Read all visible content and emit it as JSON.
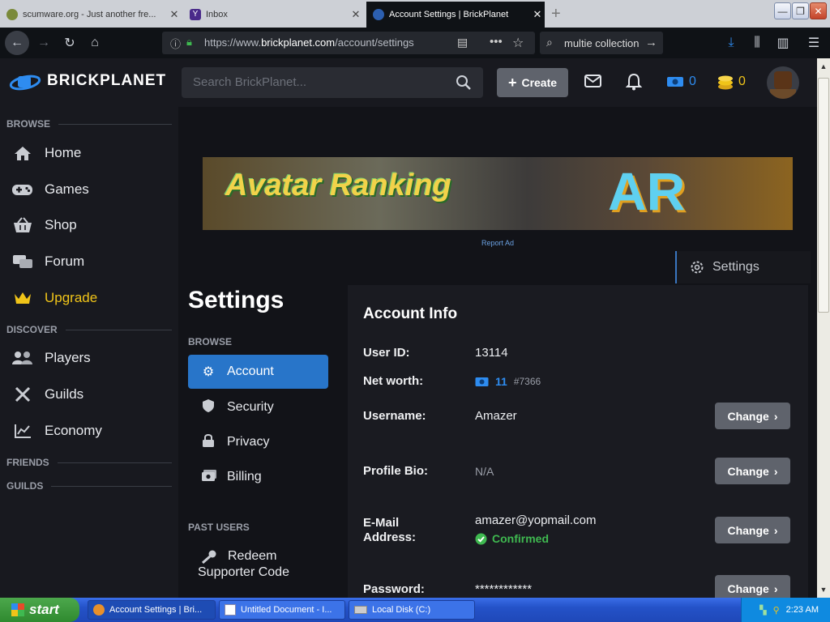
{
  "browser": {
    "tabs": [
      {
        "title": "scumware.org - Just another fre...",
        "active": false
      },
      {
        "title": "Inbox",
        "active": false
      },
      {
        "title": "Account Settings | BrickPlanet",
        "active": true
      }
    ],
    "url_prefix": "https://www.",
    "url_domain": "brickplanet.com",
    "url_path": "/account/settings",
    "search_value": "multie collection"
  },
  "header": {
    "logo": "BRICKPLANET",
    "search_placeholder": "Search BrickPlanet...",
    "create_label": "Create",
    "credits": "0",
    "bits": "0"
  },
  "sidebar": {
    "browse_label": "BROWSE",
    "browse_items": [
      {
        "label": "Home",
        "icon": "home-icon"
      },
      {
        "label": "Games",
        "icon": "gamepad-icon"
      },
      {
        "label": "Shop",
        "icon": "basket-icon"
      },
      {
        "label": "Forum",
        "icon": "comments-icon"
      },
      {
        "label": "Upgrade",
        "icon": "crown-icon"
      }
    ],
    "discover_label": "DISCOVER",
    "discover_items": [
      {
        "label": "Players",
        "icon": "users-icon"
      },
      {
        "label": "Guilds",
        "icon": "swords-icon"
      },
      {
        "label": "Economy",
        "icon": "chart-icon"
      }
    ],
    "friends_label": "FRIENDS",
    "guilds_label": "GUILDS"
  },
  "ad": {
    "banner_title": "Avatar Ranking",
    "banner_mark": "AR",
    "report_label": "Report Ad"
  },
  "settings_tab": "Settings",
  "settings": {
    "title": "Settings",
    "browse_label": "BROWSE",
    "items": [
      {
        "label": "Account",
        "selected": true
      },
      {
        "label": "Security",
        "selected": false
      },
      {
        "label": "Privacy",
        "selected": false
      },
      {
        "label": "Billing",
        "selected": false
      }
    ],
    "past_users_label": "PAST USERS",
    "redeem_line1": "Redeem",
    "redeem_line2": "Supporter Code"
  },
  "account": {
    "title": "Account Info",
    "user_id_label": "User ID:",
    "user_id": "13114",
    "net_worth_label": "Net worth:",
    "net_worth": "11",
    "net_worth_rank": "#7366",
    "username_label": "Username:",
    "username": "Amazer",
    "bio_label": "Profile Bio:",
    "bio": "N/A",
    "email_label_1": "E-Mail",
    "email_label_2": "Address:",
    "email": "amazer@yopmail.com",
    "email_status": "Confirmed",
    "password_label": "Password:",
    "password": "************",
    "change_label": "Change"
  },
  "taskbar": {
    "start": "start",
    "tasks": [
      "Account Settings | Bri...",
      "Untitled Document - I...",
      "Local Disk (C:)"
    ],
    "clock": "2:23 AM"
  },
  "colors": {
    "accent": "#2875c9",
    "upgrade": "#f0c419",
    "confirmed": "#3fb950",
    "credits": "#2e8cf0",
    "bits": "#f0c419"
  }
}
